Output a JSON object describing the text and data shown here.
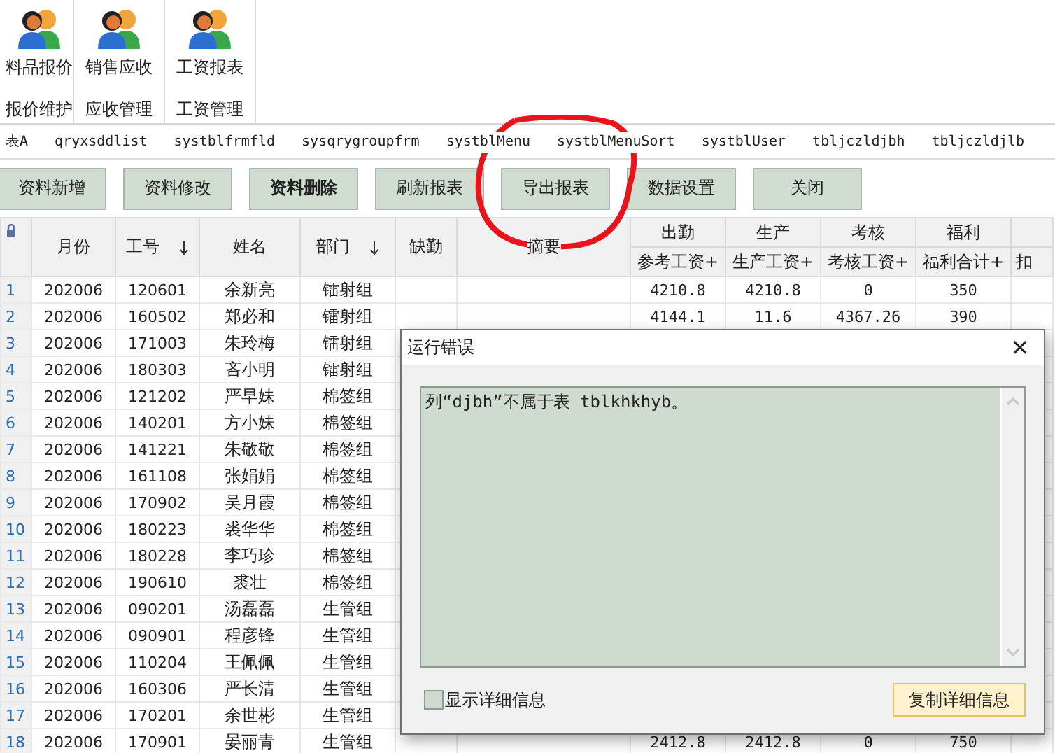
{
  "ribbon": {
    "groups": [
      {
        "items": [
          "料品报价"
        ],
        "label": "报价维护"
      },
      {
        "items": [
          "销售应收"
        ],
        "label": "应收管理"
      },
      {
        "items": [
          "工资报表"
        ],
        "label": "工资管理"
      }
    ]
  },
  "tabs": [
    {
      "label": "表A",
      "selected": false
    },
    {
      "label": "qryxsddlist",
      "selected": false
    },
    {
      "label": "systblfrmfld",
      "selected": false
    },
    {
      "label": "sysqrygroupfrm",
      "selected": false
    },
    {
      "label": "systblMenu",
      "selected": false
    },
    {
      "label": "systblMenuSort",
      "selected": false
    },
    {
      "label": "systblUser",
      "selected": false
    },
    {
      "label": "tbljczldjbh",
      "selected": false
    },
    {
      "label": "tbljczldjlb",
      "selected": false
    }
  ],
  "toolbar": [
    {
      "label": "资料新增",
      "emphasized": false
    },
    {
      "label": "资料修改",
      "emphasized": false
    },
    {
      "label": "资料删除",
      "emphasized": true
    },
    {
      "label": "刷新报表",
      "emphasized": false
    },
    {
      "label": "导出报表",
      "emphasized": false
    },
    {
      "label": "数据设置",
      "emphasized": false
    },
    {
      "label": "关闭",
      "emphasized": false
    }
  ],
  "table": {
    "columns": [
      {
        "top": "月份",
        "sort": false
      },
      {
        "top": "工号",
        "sort": true
      },
      {
        "top": "姓名",
        "sort": false
      },
      {
        "top": "部门",
        "sort": true
      },
      {
        "top": "缺勤",
        "sort": false
      },
      {
        "top": "摘要",
        "sort": false
      },
      {
        "top": "出勤",
        "bottom": "参考工资+"
      },
      {
        "top": "生产",
        "bottom": "生产工资+"
      },
      {
        "top": "考核",
        "bottom": "考核工资+"
      },
      {
        "top": "福利",
        "bottom": "福利合计+"
      },
      {
        "bottom": "扣"
      }
    ],
    "rows": [
      {
        "n": "1",
        "cells": [
          "202006",
          "120601",
          "余新亮",
          "镭射组"
        ],
        "values": [
          "4210.8",
          "4210.8",
          "0",
          "350"
        ]
      },
      {
        "n": "2",
        "cells": [
          "202006",
          "160502",
          "郑必和",
          "镭射组"
        ],
        "values": [
          "4144.1",
          "11.6",
          "4367.26",
          "390"
        ]
      },
      {
        "n": "3",
        "cells": [
          "202006",
          "171003",
          "朱玲梅",
          "镭射组"
        ]
      },
      {
        "n": "4",
        "cells": [
          "202006",
          "180303",
          "吝小明",
          "镭射组"
        ]
      },
      {
        "n": "5",
        "cells": [
          "202006",
          "121202",
          "严早妹",
          "棉签组"
        ]
      },
      {
        "n": "6",
        "cells": [
          "202006",
          "140201",
          "方小妹",
          "棉签组"
        ]
      },
      {
        "n": "7",
        "cells": [
          "202006",
          "141221",
          "朱敬敬",
          "棉签组"
        ]
      },
      {
        "n": "8",
        "cells": [
          "202006",
          "161108",
          "张娟娟",
          "棉签组"
        ]
      },
      {
        "n": "9",
        "cells": [
          "202006",
          "170902",
          "吴月霞",
          "棉签组"
        ]
      },
      {
        "n": "10",
        "cells": [
          "202006",
          "180223",
          "裘华华",
          "棉签组"
        ]
      },
      {
        "n": "11",
        "cells": [
          "202006",
          "180228",
          "李巧珍",
          "棉签组"
        ]
      },
      {
        "n": "12",
        "cells": [
          "202006",
          "190610",
          "裘壮",
          "棉签组"
        ]
      },
      {
        "n": "13",
        "cells": [
          "202006",
          "090201",
          "汤磊磊",
          "生管组"
        ]
      },
      {
        "n": "14",
        "cells": [
          "202006",
          "090901",
          "程彦锋",
          "生管组"
        ]
      },
      {
        "n": "15",
        "cells": [
          "202006",
          "110204",
          "王佩佩",
          "生管组"
        ]
      },
      {
        "n": "16",
        "cells": [
          "202006",
          "160306",
          "严长清",
          "生管组"
        ]
      },
      {
        "n": "17",
        "cells": [
          "202006",
          "170201",
          "余世彬",
          "生管组"
        ]
      },
      {
        "n": "18",
        "cells": [
          "202006",
          "170901",
          "晏丽青",
          "生管组"
        ],
        "values": [
          "2412.8",
          "2412.8",
          "0",
          "750"
        ]
      }
    ]
  },
  "dialog": {
    "title": "运行错误",
    "close": "✕",
    "message": "列“djbh”不属于表 tblkhkhyb。",
    "details_checkbox": {
      "label": "显示详细信息",
      "checked": false
    },
    "button": "复制详细信息"
  }
}
